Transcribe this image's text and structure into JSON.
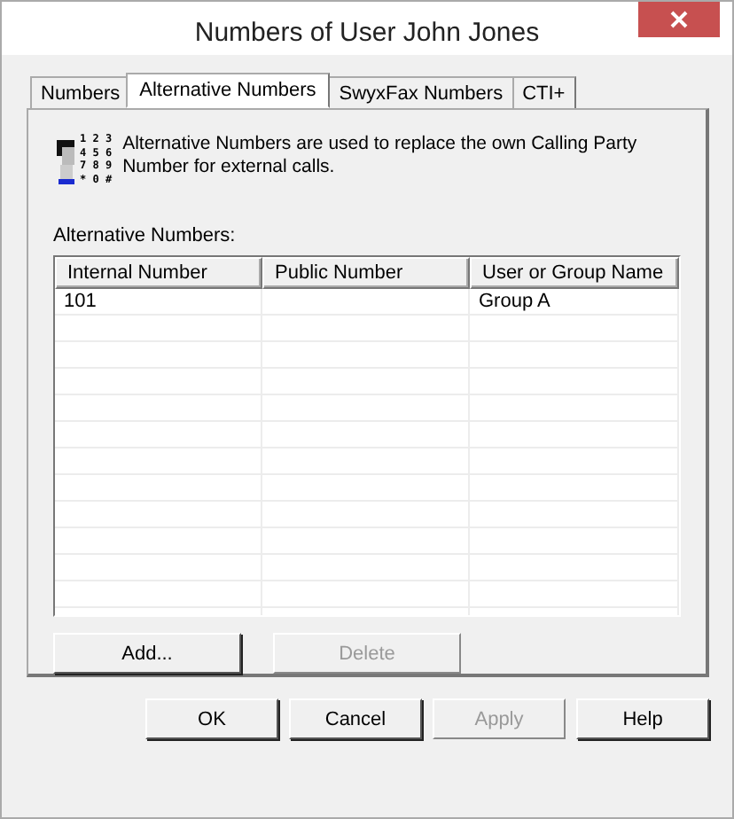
{
  "window": {
    "title": "Numbers of User John Jones"
  },
  "tabs": [
    {
      "label": "Numbers",
      "selected": false
    },
    {
      "label": "Alternative Numbers",
      "selected": true
    },
    {
      "label": "SwyxFax Numbers",
      "selected": false
    },
    {
      "label": "CTI+",
      "selected": false
    }
  ],
  "info": {
    "keypad": [
      "1 2 3",
      "4 5 6",
      "7 8 9",
      "* 0 #"
    ],
    "text": "Alternative Numbers are used to replace the own Calling Party Number for external calls."
  },
  "list_label": "Alternative Numbers:",
  "table": {
    "columns": [
      "Internal Number",
      "Public Number",
      "User or Group Name"
    ],
    "rows": [
      {
        "internal_number": "101",
        "user_or_group_name": "Group A"
      }
    ]
  },
  "list_buttons": [
    {
      "label": "Add...",
      "disabled": false
    },
    {
      "label": "Delete",
      "disabled": true
    }
  ],
  "dialog_buttons": [
    {
      "label": "OK",
      "disabled": false
    },
    {
      "label": "Cancel",
      "disabled": false
    },
    {
      "label": "Apply",
      "disabled": true
    },
    {
      "label": "Help",
      "disabled": false
    }
  ]
}
